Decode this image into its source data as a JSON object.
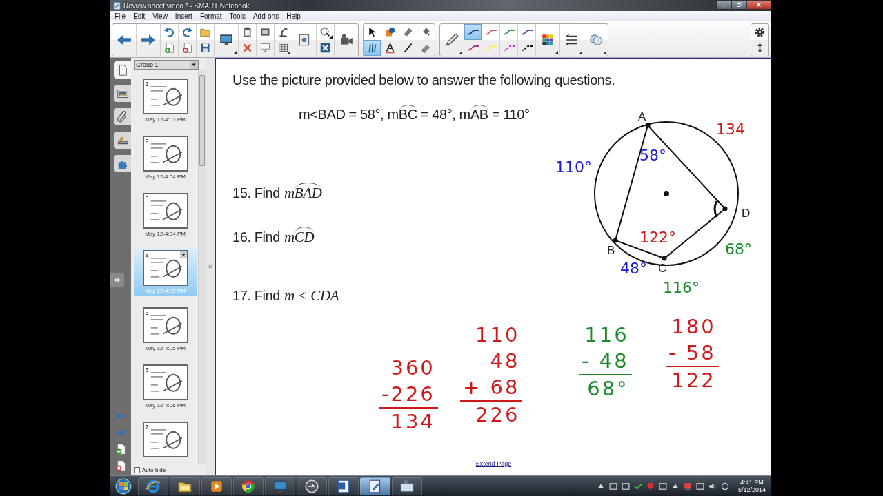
{
  "window": {
    "title": "Review sheet video * - SMART Notebook"
  },
  "menu": [
    "File",
    "Edit",
    "View",
    "Insert",
    "Format",
    "Tools",
    "Add-ons",
    "Help"
  ],
  "toolbar": {
    "groups": [
      {
        "columns": [
          [
            {
              "kind": "back",
              "selected": false
            }
          ],
          [
            {
              "kind": "forward",
              "selected": false
            }
          ],
          [
            {
              "kind": "undo",
              "selected": false
            },
            {
              "kind": "new-page",
              "selected": false
            }
          ],
          [
            {
              "kind": "redo",
              "selected": false
            },
            {
              "kind": "delete-page",
              "selected": false
            }
          ],
          [
            {
              "kind": "open",
              "selected": false
            },
            {
              "kind": "save",
              "selected": false
            }
          ],
          [
            {
              "kind": "display",
              "selected": false
            }
          ],
          [
            {
              "kind": "paste",
              "selected": false
            },
            {
              "kind": "delete",
              "selected": false
            }
          ],
          [
            {
              "kind": "capture",
              "selected": false
            },
            {
              "kind": "shade",
              "selected": false
            }
          ],
          [
            {
              "kind": "doc-camera",
              "selected": false
            },
            {
              "kind": "table",
              "selected": false
            }
          ],
          [
            {
              "kind": "properties",
              "selected": false
            }
          ],
          [
            {
              "kind": "measure",
              "selected": false
            },
            {
              "kind": "close-box",
              "selected": false
            }
          ],
          [
            {
              "kind": "recorder",
              "selected": false
            }
          ]
        ]
      },
      {
        "columns": [
          [
            {
              "kind": "select",
              "selected": false
            },
            {
              "kind": "pens",
              "selected": true
            }
          ],
          [
            {
              "kind": "shapes",
              "selected": false
            },
            {
              "kind": "text",
              "selected": false
            }
          ],
          [
            {
              "kind": "marker",
              "selected": false
            },
            {
              "kind": "line",
              "selected": false
            }
          ],
          [
            {
              "kind": "fill",
              "selected": false
            },
            {
              "kind": "eraser",
              "selected": false
            }
          ]
        ]
      },
      {
        "columns": [
          [
            {
              "kind": "pen",
              "selected": false
            }
          ],
          [
            {
              "kind": "pen-style",
              "color": "#1f3f7f",
              "selected": true
            },
            {
              "kind": "pen-style",
              "color": "#a04080",
              "selected": false
            }
          ],
          [
            {
              "kind": "pen-style",
              "color": "#e06070",
              "selected": false
            },
            {
              "kind": "pen-style",
              "color": "#f0f060",
              "selected": false
            }
          ],
          [
            {
              "kind": "pen-style",
              "color": "#409050",
              "selected": false
            },
            {
              "kind": "dash-style",
              "color": "#e020e0",
              "selected": false
            }
          ],
          [
            {
              "kind": "pen-style",
              "color": "#5050a0",
              "selected": false
            },
            {
              "kind": "dash-style",
              "color": "#000000",
              "selected": false
            }
          ],
          [
            {
              "kind": "palette",
              "selected": false
            }
          ],
          [
            {
              "kind": "line-style",
              "selected": false
            }
          ],
          [
            {
              "kind": "transparency",
              "selected": false
            }
          ]
        ]
      },
      {
        "columns": [
          [
            {
              "kind": "gear",
              "selected": false
            },
            {
              "kind": "updown",
              "selected": false
            }
          ]
        ]
      }
    ]
  },
  "sidebar": {
    "tabs": [
      {
        "kind": "pages",
        "selected": true
      },
      {
        "kind": "gallery",
        "selected": false
      },
      {
        "kind": "attachments",
        "selected": false
      },
      {
        "kind": "properties",
        "selected": false
      },
      {
        "kind": "addons",
        "selected": false
      }
    ],
    "nav": [
      {
        "kind": "prev"
      },
      {
        "kind": "next"
      },
      {
        "kind": "add"
      },
      {
        "kind": "remove"
      }
    ],
    "group": "Group 1",
    "pages": [
      {
        "number": "1",
        "time": "May 12-4:03 PM",
        "selected": false
      },
      {
        "number": "2",
        "time": "May 12-4:04 PM",
        "selected": false
      },
      {
        "number": "3",
        "time": "May 12-4:04 PM",
        "selected": false
      },
      {
        "number": "4",
        "time": "May 12-4:05 PM",
        "selected": true
      },
      {
        "number": "5",
        "time": "May 12-4:05 PM",
        "selected": false
      },
      {
        "number": "6",
        "time": "May 12-4:06 PM",
        "selected": false
      },
      {
        "number": "7",
        "selected": false
      }
    ],
    "auto_hide": {
      "label": "Auto-hide",
      "checked": false
    }
  },
  "canvas": {
    "heading": "Use the picture provided below to answer the following questions.",
    "given": [
      {
        "text": "m<BAD = 58°, m",
        "arc": false
      },
      {
        "text": "BC",
        "arc": true
      },
      {
        "text": " = 48°, m",
        "arc": false
      },
      {
        "text": "AB",
        "arc": true
      },
      {
        "text": " = 110°",
        "arc": false
      }
    ],
    "questions": [
      {
        "number": "15.",
        "label": "Find",
        "expr": [
          {
            "text": "m",
            "arc": false
          },
          {
            "text": "BAD",
            "arc": true
          }
        ]
      },
      {
        "number": "16.",
        "label": "Find",
        "expr": [
          {
            "text": "m",
            "arc": false
          },
          {
            "text": "CD",
            "arc": true
          }
        ]
      },
      {
        "number": "17.",
        "label": "Find",
        "expr": [
          {
            "text": "m < CDA",
            "arc": false
          }
        ]
      }
    ],
    "diagram": {
      "points": [
        {
          "label": "A"
        },
        {
          "label": "B"
        },
        {
          "label": "C"
        },
        {
          "label": "D"
        }
      ],
      "notes": [
        {
          "text": "110°",
          "color": "#1a1ad0"
        },
        {
          "text": "58°",
          "color": "#1a1ad0"
        },
        {
          "text": "134",
          "color": "#d01818"
        },
        {
          "text": "122°",
          "color": "#d01818"
        },
        {
          "text": "68°",
          "color": "#1a8a2a"
        },
        {
          "text": "48°",
          "color": "#1a1ad0"
        },
        {
          "text": "116°",
          "color": "#1a8a2a"
        }
      ]
    },
    "work": [
      {
        "lines": [
          "360",
          "-226"
        ],
        "result": "134",
        "color": "#d01818"
      },
      {
        "lines": [
          "110",
          "48",
          "+ 68"
        ],
        "result": "226",
        "color": "#d01818"
      },
      {
        "lines": [
          "116",
          "- 48"
        ],
        "result": "68°",
        "color": "#1a8a2a"
      },
      {
        "lines": [
          "180",
          "- 58"
        ],
        "result": "122",
        "color": "#d01818"
      }
    ],
    "extend_link": "Extend Page"
  },
  "taskbar": {
    "apps": [
      {
        "kind": "globe",
        "active": false
      },
      {
        "kind": "folder",
        "active": false
      },
      {
        "kind": "media",
        "active": false
      },
      {
        "kind": "browser",
        "active": false
      },
      {
        "kind": "board",
        "active": false
      },
      {
        "kind": "clock",
        "active": false
      },
      {
        "kind": "word",
        "active": false
      },
      {
        "kind": "notebook",
        "active": true
      },
      {
        "kind": "tool",
        "active": false
      }
    ],
    "tray": [
      {
        "kind": "arrow"
      },
      {
        "kind": "window"
      },
      {
        "kind": "window"
      },
      {
        "kind": "check"
      },
      {
        "kind": "shield"
      },
      {
        "kind": "window"
      },
      {
        "kind": "arrow"
      },
      {
        "kind": "flag"
      },
      {
        "kind": "window"
      },
      {
        "kind": "speaker"
      },
      {
        "kind": "ring"
      }
    ],
    "time": "4:41 PM",
    "date": "5/12/2014"
  }
}
